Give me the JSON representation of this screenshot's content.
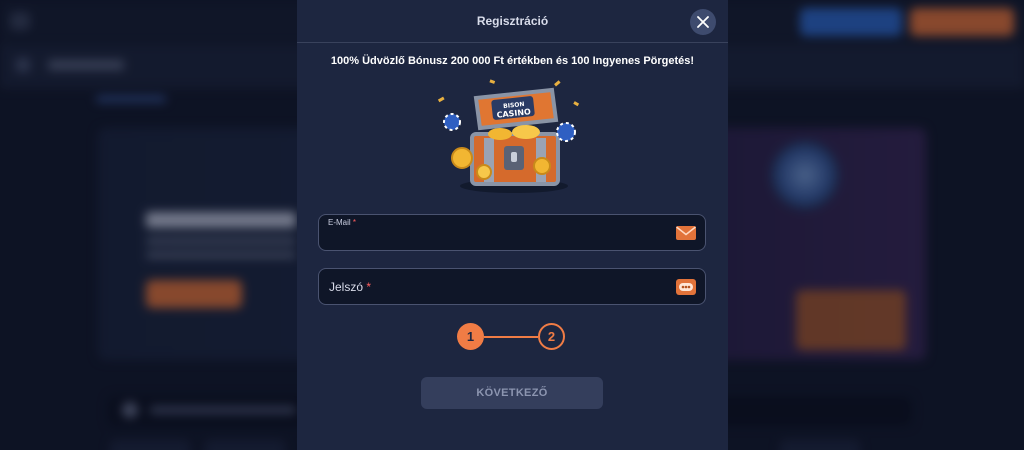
{
  "modal": {
    "title": "Regisztráció",
    "promo": "100% Üdvözlő Bónusz 200 000 Ft értékben és 100 Ingyenes Pörgetés!",
    "chest_logo_line1": "BISON",
    "chest_logo_line2": "CASINO",
    "email": {
      "label": "E-Mail",
      "required_mark": "*",
      "value": "",
      "icon": "envelope-icon"
    },
    "password": {
      "label": "Jelszó",
      "required_mark": "*",
      "value": "",
      "icon": "password-key-icon"
    },
    "steps": [
      {
        "label": "1",
        "active": true
      },
      {
        "label": "2",
        "active": false
      }
    ],
    "next_button": "KÖVETKEZŐ",
    "close_icon": "close-icon"
  },
  "colors": {
    "modal_bg": "#1d2640",
    "accent": "#f07c45",
    "input_bg": "#0f1628",
    "button_disabled": "#343e5c"
  }
}
